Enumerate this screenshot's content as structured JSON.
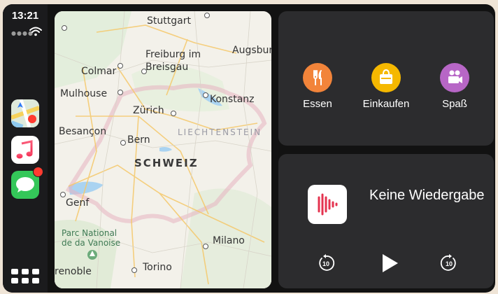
{
  "status": {
    "time": "13:21"
  },
  "sidebar": {
    "apps": [
      {
        "name": "maps-app-icon"
      },
      {
        "name": "music-app-icon"
      },
      {
        "name": "messages-app-icon"
      }
    ]
  },
  "map": {
    "labels": {
      "stuttgart": "Stuttgart",
      "augsburg": "Augsbur",
      "freiburg": "Freiburg im",
      "breisgau": "Breisgau",
      "colmar": "Colmar",
      "mulhouse": "Mulhouse",
      "konstanz": "Konstanz",
      "zurich": "Zürich",
      "besancon": "Besançon",
      "bern": "Bern",
      "liechtenstein": "LIECHTENSTEIN",
      "schweiz": "SCHWEIZ",
      "genf": "Genf",
      "park_line1": "Parc National",
      "park_line2": "de da Vanoise",
      "milano": "Milano",
      "torino": "Torino",
      "grenoble": "renoble"
    }
  },
  "suggestions": {
    "items": [
      {
        "label": "Essen",
        "color": "#f2843a",
        "icon": "fork-knife-icon"
      },
      {
        "label": "Einkaufen",
        "color": "#f5b800",
        "icon": "shopping-bag-icon"
      },
      {
        "label": "Spaß",
        "color": "#b766c6",
        "icon": "movie-camera-icon"
      }
    ]
  },
  "now_playing": {
    "title": "Keine Wiedergabe",
    "skip_back_seconds": "10",
    "skip_forward_seconds": "10"
  }
}
